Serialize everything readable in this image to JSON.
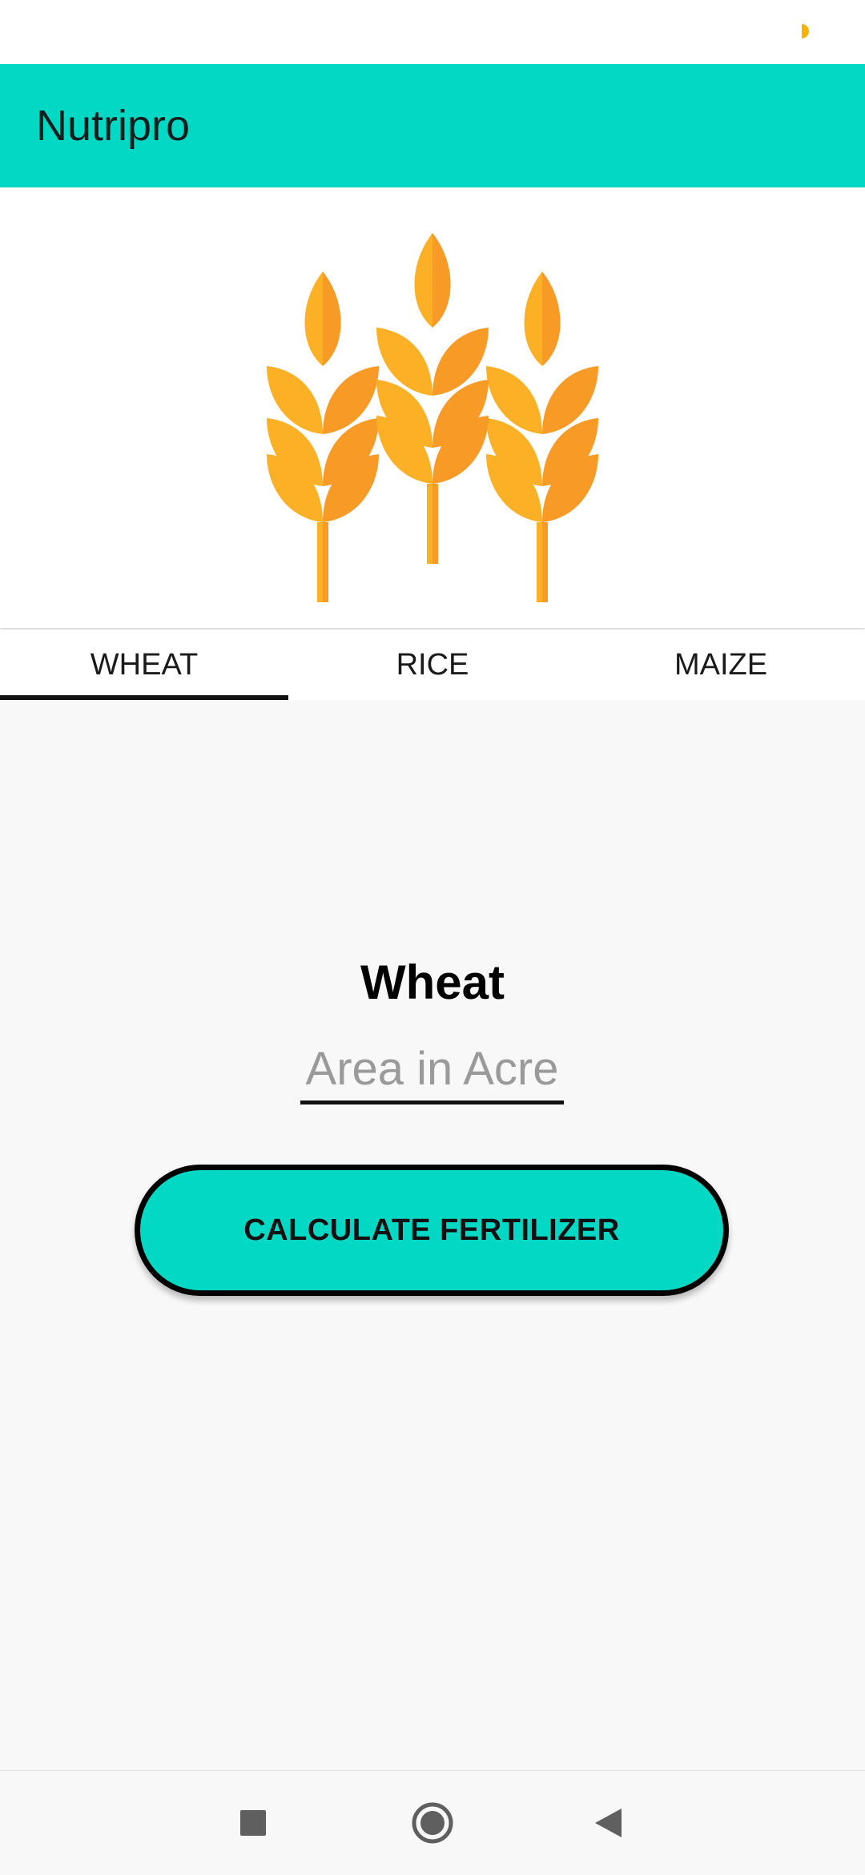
{
  "app": {
    "title": "Nutripro",
    "accent_color": "#03d8c4"
  },
  "header_image": {
    "icon": "wheat-stalks-icon",
    "colors": [
      "#fbb025",
      "#f79a26"
    ]
  },
  "tabs": [
    {
      "label": "WHEAT",
      "active": true
    },
    {
      "label": "RICE",
      "active": false
    },
    {
      "label": "MAIZE",
      "active": false
    }
  ],
  "main": {
    "crop_title": "Wheat",
    "area_input": {
      "placeholder": "Area in Acre",
      "value": ""
    },
    "calculate_button_label": "CALCULATE FERTILIZER"
  },
  "nav_bar": {
    "recents_icon": "square-icon",
    "home_icon": "circle-icon",
    "back_icon": "triangle-back-icon"
  }
}
